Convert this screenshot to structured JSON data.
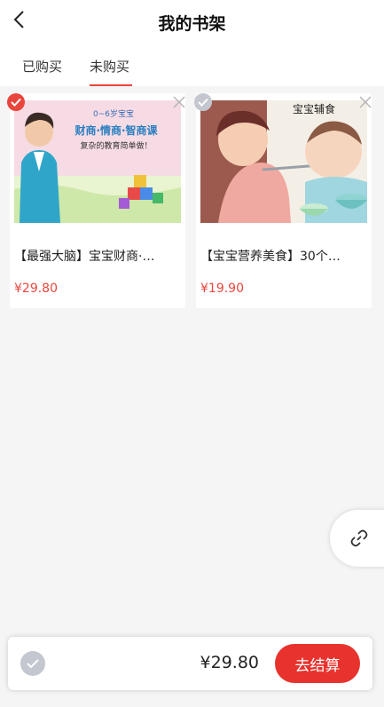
{
  "header": {
    "title": "我的书架",
    "back_icon": "chevron-left-icon"
  },
  "tabs": [
    {
      "label": "已购买",
      "active": false
    },
    {
      "label": "未购买",
      "active": true
    }
  ],
  "items": [
    {
      "title": "【最强大脑】宝宝财商·…",
      "price": "¥29.80",
      "selected": true,
      "thumb_top": "0~6岁宝宝",
      "thumb_main": "财商·情商·智商课",
      "thumb_sub": "复杂的教育简单做！"
    },
    {
      "title": "【宝宝营养美食】30个…",
      "price": "¥19.90",
      "selected": false,
      "thumb_text": "宝宝辅食"
    }
  ],
  "bottom": {
    "total": "¥29.80",
    "checkout_label": "去结算"
  },
  "colors": {
    "accent": "#e8463c",
    "checkout": "#e8322d",
    "unselected": "#c4c7cf"
  }
}
